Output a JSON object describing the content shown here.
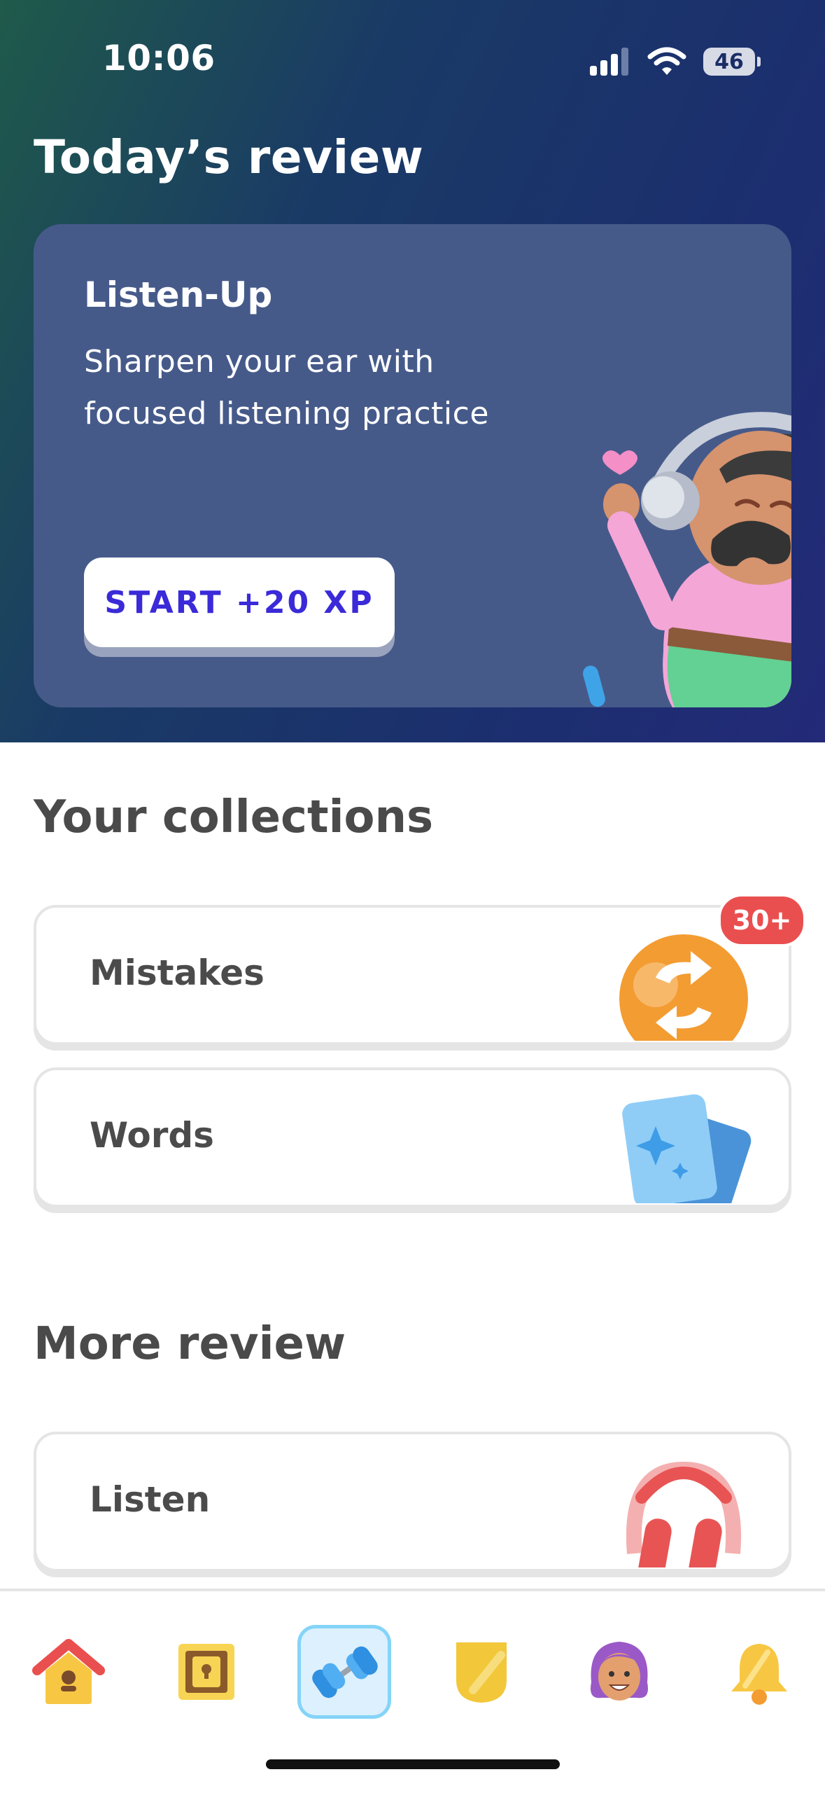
{
  "status_bar": {
    "time": "10:06",
    "battery": "46"
  },
  "todays_review": {
    "title": "Today’s review",
    "card": {
      "title": "Listen-Up",
      "description": "Sharpen your ear with focused listening practice",
      "button_label": "START +20 XP"
    }
  },
  "collections": {
    "title": "Your collections",
    "items": [
      {
        "label": "Mistakes",
        "badge": "30+",
        "icon": "mistakes-icon"
      },
      {
        "label": "Words",
        "icon": "words-icon"
      }
    ]
  },
  "more_review": {
    "title": "More review",
    "items": [
      {
        "label": "Listen",
        "icon": "headphones-icon"
      }
    ]
  },
  "bottom_nav": {
    "items": [
      "home-icon",
      "treasure-chest-icon",
      "practice-dumbbell-icon",
      "league-shield-icon",
      "profile-avatar-icon",
      "notifications-bell-icon"
    ],
    "active": "practice-dumbbell-icon"
  },
  "colors": {
    "hero_gradient_start": "#1f5a4a",
    "hero_gradient_end": "#232a78",
    "card_bg": "#465a8a",
    "button_text": "#3a2ad8",
    "badge": "#ea4f4f",
    "nav_active_bg": "#ddf0fd",
    "nav_active_border": "#84d4f8"
  }
}
